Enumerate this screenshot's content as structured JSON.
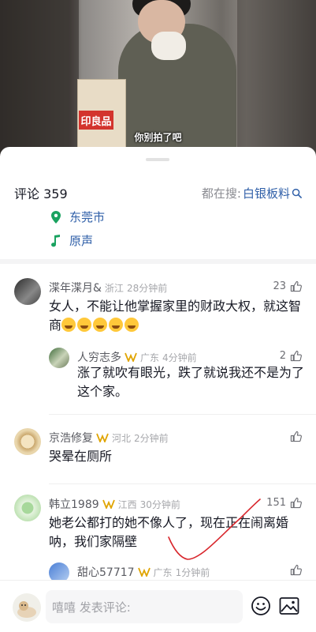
{
  "video": {
    "subtitle": "你别拍了吧",
    "bag_label": "印良品"
  },
  "header": {
    "count_label": "评论 359",
    "search_prefix": "都在搜:",
    "search_term": "白银板料"
  },
  "post_info": {
    "location": "东莞市",
    "music": "原声"
  },
  "comments": [
    {
      "name": "渫年渫月&",
      "region": "浙江",
      "time": "28分钟前",
      "likes": "23",
      "text": "女人，不能让他掌握家里的财政大权，就这智商"
    },
    {
      "name": "人穷志多",
      "region": "广东",
      "time": "4分钟前",
      "likes": "2",
      "text": "涨了就吹有眼光，跌了就说我还不是为了这个家。"
    },
    {
      "name": "京浩修复",
      "region": "河北",
      "time": "2分钟前",
      "likes": "",
      "text": "哭晕在厕所"
    },
    {
      "name": "韩立1989",
      "region": "江西",
      "time": "30分钟前",
      "likes": "151",
      "text": "她老公都打的她不像人了，现在正在闹离婚呐，我们家隔壁"
    },
    {
      "name": "甜心57717",
      "region": "广东",
      "time": "1分钟前",
      "likes": "",
      "text": ""
    }
  ],
  "input": {
    "placeholder": "嘻嘻 发表评论:"
  },
  "colors": {
    "link_blue": "#2f5fa8",
    "badge_gold": "#e0a400",
    "location_green": "#1aa260",
    "annotation_red": "#d8262c"
  },
  "icons": [
    "location-pin-icon",
    "music-note-icon",
    "search-icon",
    "thumb-up-icon",
    "emoji-icon",
    "image-icon",
    "badge-icon"
  ]
}
